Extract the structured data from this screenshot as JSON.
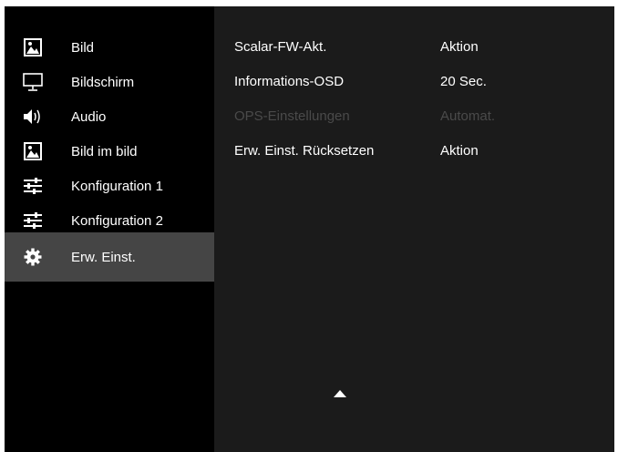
{
  "sidebar": {
    "items": [
      {
        "label": "Bild",
        "icon": "picture-icon"
      },
      {
        "label": "Bildschirm",
        "icon": "monitor-icon"
      },
      {
        "label": "Audio",
        "icon": "speaker-icon"
      },
      {
        "label": "Bild im bild",
        "icon": "picture-in-picture-icon"
      },
      {
        "label": "Konfiguration 1",
        "icon": "sliders-icon"
      },
      {
        "label": "Konfiguration 2",
        "icon": "sliders-icon"
      },
      {
        "label": "Erw. Einst.",
        "icon": "gear-icon",
        "selected": true
      }
    ]
  },
  "main": {
    "rows": [
      {
        "name": "Scalar-FW-Akt.",
        "value": "Aktion",
        "enabled": true
      },
      {
        "name": "Informations-OSD",
        "value": "20 Sec.",
        "enabled": true
      },
      {
        "name": "OPS-Einstellungen",
        "value": "Automat.",
        "enabled": false
      },
      {
        "name": "Erw. Einst. Rücksetzen",
        "value": "Aktion",
        "enabled": true
      }
    ],
    "scroll_indicator_icon": "triangle-up-icon"
  },
  "colors": {
    "sidebar_bg": "#000000",
    "selected_bg": "#454545",
    "main_bg": "#1b1b1b",
    "text": "#ffffff",
    "disabled_text": "#4a4a4a"
  }
}
